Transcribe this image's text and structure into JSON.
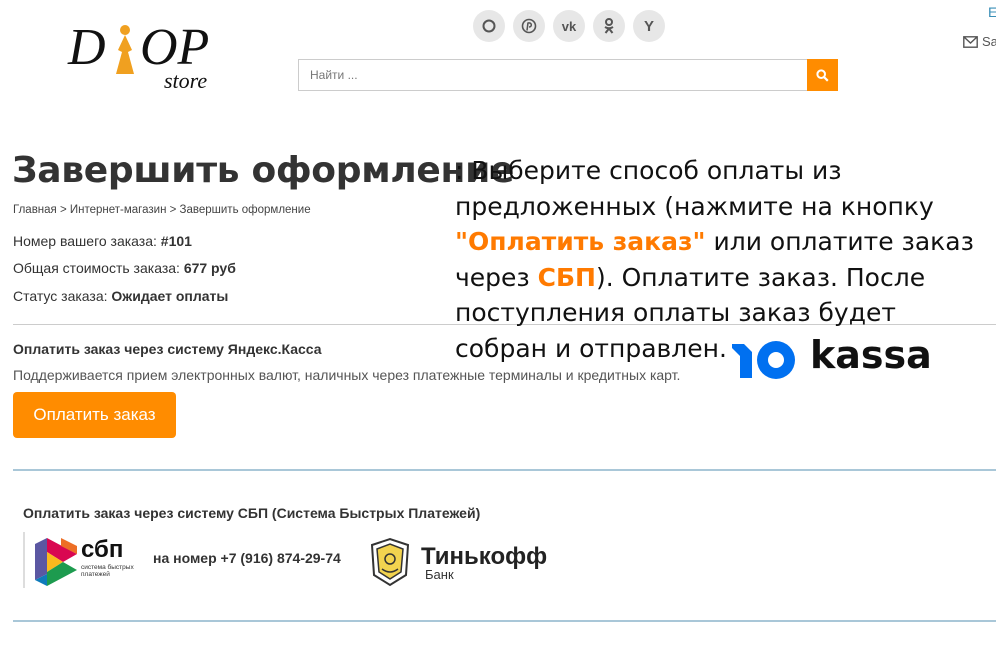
{
  "header": {
    "logo": {
      "text": "D OP",
      "sub": "store"
    },
    "social_icons": [
      "odnoklassniki-circle-icon",
      "pinterest-icon",
      "vk-icon",
      "ok-icon",
      "yandex-icon"
    ],
    "social_glyphs": [
      "○",
      "℗",
      "vk",
      "✪",
      "Y"
    ],
    "top_right_letter": "E",
    "mail_text": "Sa"
  },
  "search": {
    "placeholder": "Найти ...",
    "button_icon": "search-icon",
    "accent": "#ff8c00"
  },
  "page": {
    "title": "Завершить оформление",
    "breadcrumb": "Главная > Интернет-магазин > Завершить оформление"
  },
  "order": {
    "number_label": "Номер вашего заказа:",
    "number_value": "#101",
    "total_label": "Общая стоимость заказа:",
    "total_value": "677 руб",
    "status_label": "Статус заказа:",
    "status_value": "Ожидает оплаты"
  },
  "yandex_kassa": {
    "title": "Оплатить заказ через систему Яндекс.Касса",
    "description": "Поддерживается прием электронных валют, наличных через платежные терминалы и кредитных карт.",
    "button_label": "Оплатить заказ",
    "logo_text": "kassa"
  },
  "sbp": {
    "title": "Оплатить заказ через систему СБП (Система Быстрых Платежей)",
    "logo_text": "сбп",
    "logo_sub": "система быстрых платежей",
    "phone_text": "на номер +7 (916) 874-29-74",
    "bank_name": "Тинькофф",
    "bank_sub": "Банк"
  },
  "overlay": {
    "part1": ": Выберите способ оплаты из предложенных (нажмите на кнопку ",
    "highlight1": "\"Оплатить заказ\"",
    "part2": " или оплатите заказ через ",
    "highlight2": "СБП",
    "part3": "). Оплатите заказ. После поступления оплаты заказ будет собран и отправлен."
  },
  "colors": {
    "accent": "#ff8c00",
    "highlight": "#ff7a00",
    "rule": "#a9c7d8"
  }
}
